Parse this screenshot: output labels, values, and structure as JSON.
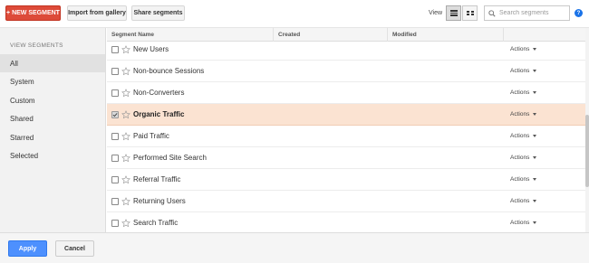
{
  "toolbar": {
    "new_segment_label": "+ NEW SEGMENT",
    "import_label": "Import from gallery",
    "share_label": "Share segments",
    "view_label": "View",
    "search_placeholder": "Search segments",
    "help_label": "?",
    "view_modes": [
      {
        "icon": "list-view-icon",
        "active": true
      },
      {
        "icon": "grid-view-icon",
        "active": false
      }
    ]
  },
  "sidebar": {
    "title": "VIEW SEGMENTS",
    "items": [
      {
        "label": "All",
        "active": true
      },
      {
        "label": "System",
        "active": false
      },
      {
        "label": "Custom",
        "active": false
      },
      {
        "label": "Shared",
        "active": false
      },
      {
        "label": "Starred",
        "active": false
      },
      {
        "label": "Selected",
        "active": false
      }
    ]
  },
  "table": {
    "columns": [
      "Segment Name",
      "Created",
      "Modified"
    ],
    "rows": [
      {
        "name": "New Users",
        "checked": false,
        "selected": false,
        "actions": "Actions"
      },
      {
        "name": "Non-bounce Sessions",
        "checked": false,
        "selected": false,
        "actions": "Actions"
      },
      {
        "name": "Non-Converters",
        "checked": false,
        "selected": false,
        "actions": "Actions"
      },
      {
        "name": "Organic Traffic",
        "checked": true,
        "selected": true,
        "actions": "Actions"
      },
      {
        "name": "Paid Traffic",
        "checked": false,
        "selected": false,
        "actions": "Actions"
      },
      {
        "name": "Performed Site Search",
        "checked": false,
        "selected": false,
        "actions": "Actions"
      },
      {
        "name": "Referral Traffic",
        "checked": false,
        "selected": false,
        "actions": "Actions"
      },
      {
        "name": "Returning Users",
        "checked": false,
        "selected": false,
        "actions": "Actions"
      },
      {
        "name": "Search Traffic",
        "checked": false,
        "selected": false,
        "actions": "Actions"
      }
    ]
  },
  "footer": {
    "apply_label": "Apply",
    "cancel_label": "Cancel"
  },
  "colors": {
    "new_segment": "#dd4b39",
    "apply": "#4d90fe",
    "selected_row": "#fbe3d2",
    "help": "#1a73e8"
  }
}
